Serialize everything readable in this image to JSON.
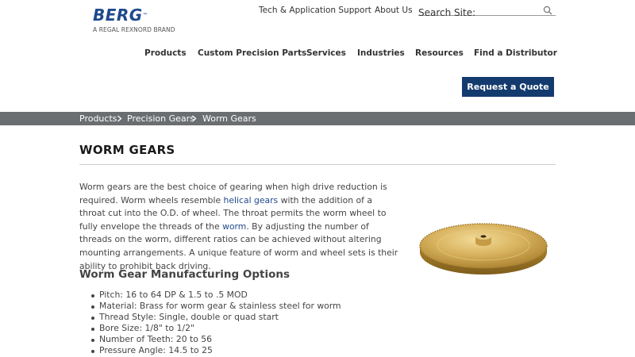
{
  "header": {
    "logo_word": "BERG",
    "logo_tm": "™",
    "logo_sub": "A REGAL REXNORD BRAND",
    "support_link": "Tech & Application Support",
    "about_link": "About Us",
    "search_placeholder": "Search Site:"
  },
  "nav": {
    "items": [
      {
        "label": "Products"
      },
      {
        "label": "Custom Precision Parts"
      },
      {
        "label": "Services"
      },
      {
        "label": "Industries"
      },
      {
        "label": "Resources"
      },
      {
        "label": "Find a Distributor"
      }
    ],
    "quote_button": "Request a Quote"
  },
  "breadcrumb": {
    "items": [
      "Products",
      "Precision Gears",
      "Worm Gears"
    ]
  },
  "main": {
    "title": "WORM GEARS",
    "intro": {
      "p1": "Worm gears are the best choice of gearing when high drive reduction is required. Worm wheels resemble ",
      "link1": "helical gears",
      "p2": " with the addition of a throat cut into the O.D. of wheel. The throat permits the worm wheel to fully envelope the threads of the ",
      "link2": "worm",
      "p3": ". By adjusting the number of threads on the worm, different ratios can be achieved without altering mounting arrangements. A unique feature of worm and wheel sets is their ability to prohibit back driving."
    },
    "subhead": "Worm Gear Manufacturing Options",
    "specs": [
      "Pitch: 16 to 64 DP & 1.5 to .5 MOD",
      "Material: Brass for worm gear & stainless steel for worm",
      "Thread Style: Single, double or quad start",
      "Bore Size: 1/8\" to 1/2\"",
      "Number of Teeth: 20 to 56",
      "Pressure Angle: 14.5 to 25"
    ]
  },
  "colors": {
    "brand_blue": "#1e4a8c",
    "button_navy": "#143b6e",
    "breadcrumb_bg": "#6b6e71",
    "brass": "#c9a24a"
  }
}
